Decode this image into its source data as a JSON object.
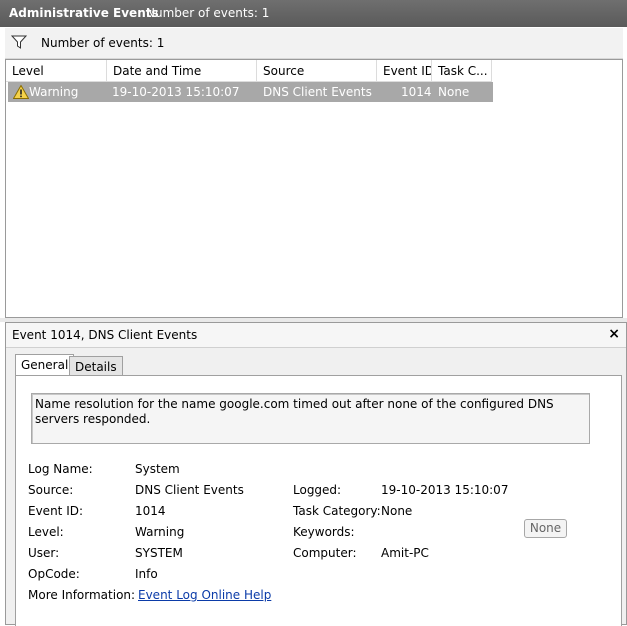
{
  "titlebar": {
    "title": "Administrative Events",
    "count": "Number of events: 1"
  },
  "filterbar": {
    "icon": "filter-icon",
    "text": "Number of events: 1"
  },
  "grid": {
    "columns": [
      "Level",
      "Date and Time",
      "Source",
      "Event ID",
      "Task C..."
    ],
    "rows": [
      {
        "icon": "warning-icon",
        "level": "Warning",
        "datetime": "19-10-2013 15:10:07",
        "source": "DNS Client Events",
        "event_id": "1014",
        "task": "None"
      }
    ],
    "selected_row_color": "#a8a8a8"
  },
  "detail": {
    "title": "Event 1014, DNS Client Events",
    "close_glyph": "×",
    "tabs": [
      "General",
      "Details"
    ],
    "active_tab": "General",
    "message": "Name resolution for the name google.com timed out after none of the configured DNS servers responded.",
    "fields": {
      "log_name_label": "Log Name:",
      "log_name": "System",
      "source_label": "Source:",
      "source": "DNS Client Events",
      "logged_label": "Logged:",
      "logged": "19-10-2013 15:10:07",
      "event_id_label": "Event ID:",
      "event_id": "1014",
      "task_category_label": "Task Category:",
      "task_category": "None",
      "level_label": "Level:",
      "level": "Warning",
      "keywords_label": "Keywords:",
      "keywords_button": "None",
      "user_label": "User:",
      "user": "SYSTEM",
      "computer_label": "Computer:",
      "computer": "Amit-PC",
      "opcode_label": "OpCode:",
      "opcode": "Info",
      "more_info_label": "More Information:",
      "more_info_link": "Event Log Online Help"
    }
  }
}
